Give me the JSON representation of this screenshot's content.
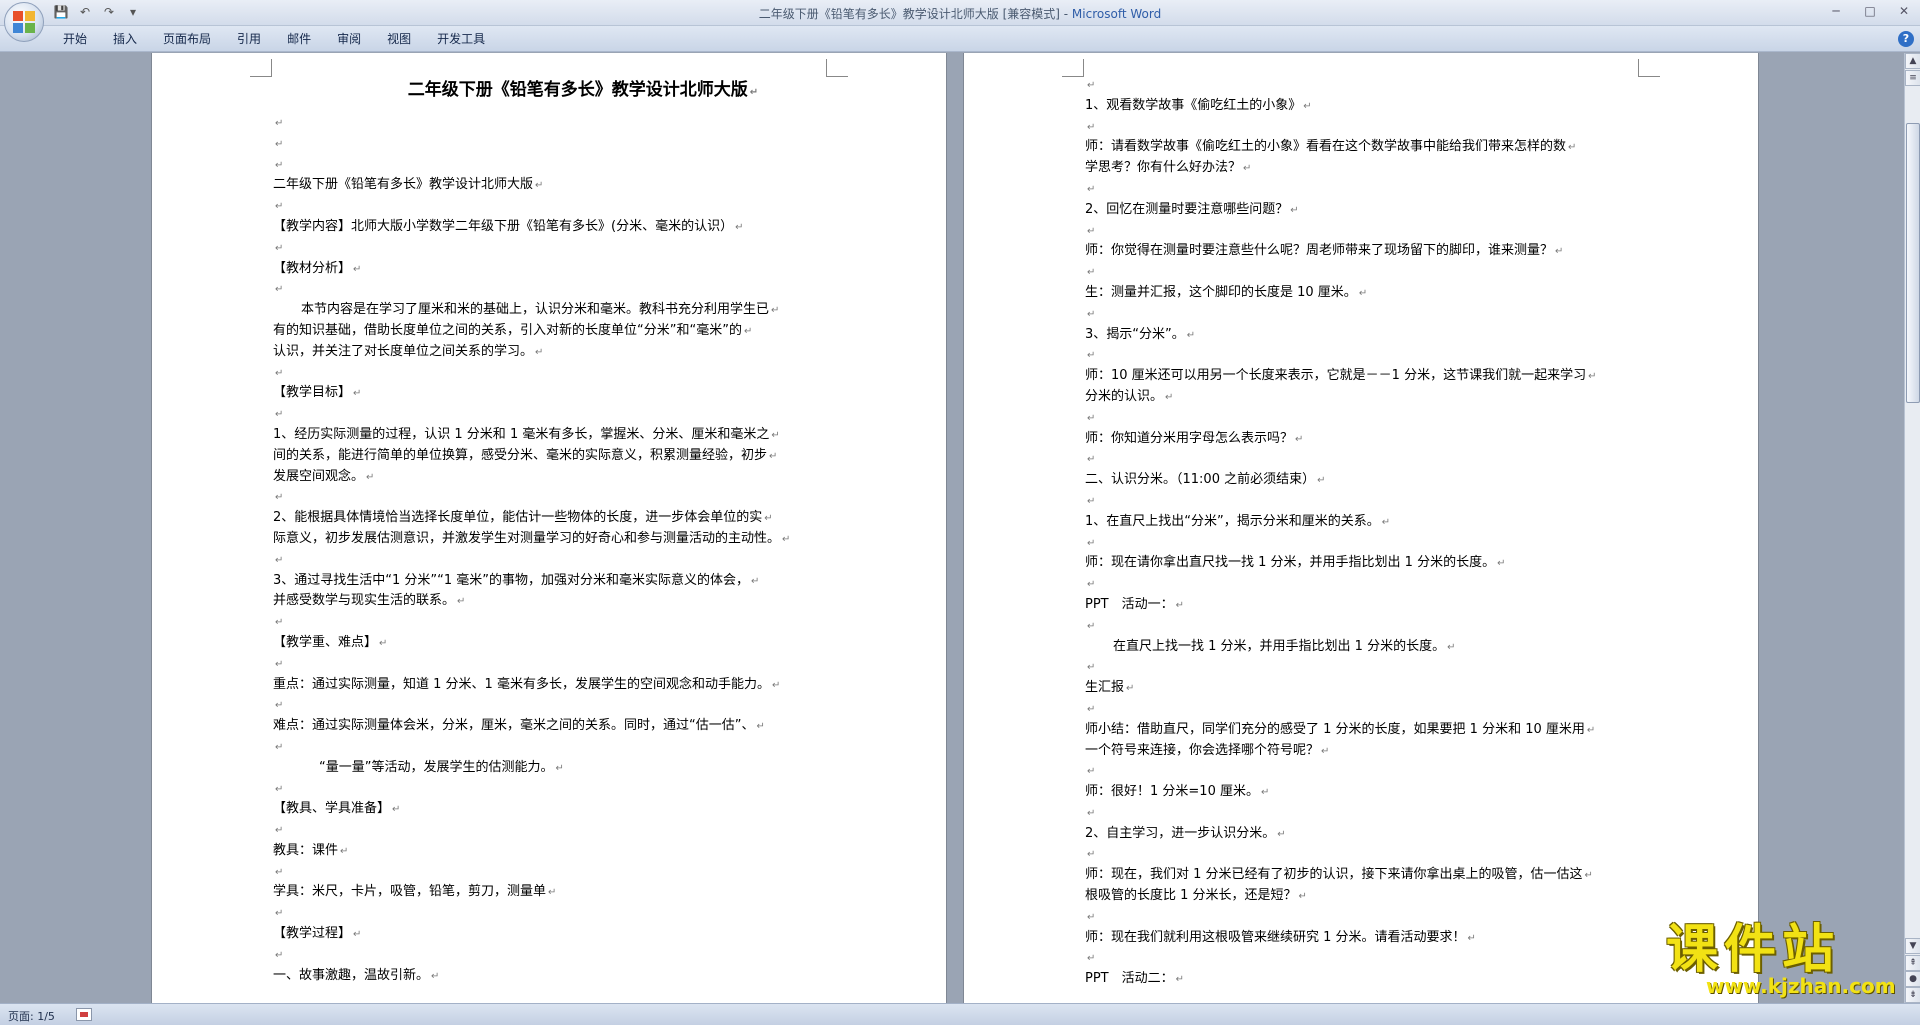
{
  "titlebar": {
    "title_main": "二年级下册《铅笔有多长》教学设计北师大版 [兼容模式] - ",
    "app_name": "Microsoft Word",
    "minimize": "─",
    "maximize": "□",
    "close": "✕"
  },
  "qat": {
    "save": "💾",
    "undo": "↶",
    "redo": "↷",
    "customize": "▾"
  },
  "menu": {
    "tabs": [
      "开始",
      "插入",
      "页面布局",
      "引用",
      "邮件",
      "审阅",
      "视图",
      "开发工具"
    ],
    "help": "?"
  },
  "paragraph_mark": "↵",
  "page_left": {
    "title": "二年级下册《铅笔有多长》教学设计北师大版",
    "lines": [
      "",
      "",
      "",
      "二年级下册《铅笔有多长》教学设计北师大版",
      "",
      "【教学内容】北师大版小学数学二年级下册《铅笔有多长》(分米、毫米的认识）",
      "",
      "【教材分析】",
      "",
      "本节内容是在学习了厘米和米的基础上，认识分米和毫米。教科书充分利用学生已",
      "有的知识基础，借助长度单位之间的关系，引入对新的长度单位“分米”和“毫米”的",
      "认识，并关注了对长度单位之间关系的学习。",
      "",
      "【教学目标】",
      "",
      "1、经历实际测量的过程，认识 1 分米和 1 毫米有多长，掌握米、分米、厘米和毫米之",
      "间的关系，能进行简单的单位换算，感受分米、毫米的实际意义，积累测量经验，初步",
      "发展空间观念。",
      "",
      "2、能根据具体情境恰当选择长度单位，能估计一些物体的长度，进一步体会单位的实",
      "际意义，初步发展估测意识，并激发学生对测量学习的好奇心和参与测量活动的主动性。",
      "",
      "3、通过寻找生活中“1 分米”“1 毫米”的事物，加强对分米和毫米实际意义的体会，",
      "并感受数学与现实生活的联系。",
      "",
      "【教学重、难点】",
      "",
      "重点：通过实际测量，知道 1 分米、1 毫米有多长，发展学生的空间观念和动手能力。",
      "",
      "难点：通过实际测量体会米，分米，厘米，毫米之间的关系。同时，通过“估一估”、",
      "",
      "“量一量”等活动，发展学生的估测能力。",
      "",
      "【教具、学具准备】",
      "",
      "教具：课件",
      "",
      "学具：米尺，卡片，吸管，铅笔，剪刀，测量单",
      "",
      "【教学过程】",
      "",
      "一、故事激趣，温故引新。"
    ]
  },
  "page_right": {
    "lines": [
      "",
      "1、观看数学故事《偷吃红土的小象》",
      "",
      "师：请看数学故事《偷吃红土的小象》看看在这个数学故事中能给我们带来怎样的数",
      "学思考？你有什么好办法？",
      "",
      "2、回忆在测量时要注意哪些问题？",
      "",
      "师：你觉得在测量时要注意些什么呢？周老师带来了现场留下的脚印，谁来测量？",
      "",
      "生：测量并汇报，这个脚印的长度是 10 厘米。",
      "",
      "3、揭示“分米”。",
      "",
      "师：10 厘米还可以用另一个长度来表示，它就是－－1 分米，这节课我们就一起来学习",
      "分米的认识。",
      "",
      "师：你知道分米用字母怎么表示吗？",
      "",
      "二、认识分米。（11:00 之前必须结束）",
      "",
      "1、在直尺上找出“分米”，揭示分米和厘米的关系。",
      "",
      "师：现在请你拿出直尺找一找 1 分米，并用手指比划出 1 分米的长度。",
      "",
      "PPT　活动一：",
      "",
      "在直尺上找一找 1 分米，并用手指比划出 1 分米的长度。",
      "",
      "生汇报",
      "",
      "师小结：借助直尺，同学们充分的感受了 1 分米的长度，如果要把 1 分米和 10 厘米用",
      "一个符号来连接，你会选择哪个符号呢？",
      "",
      "师：很好！1 分米=10 厘米。",
      "",
      "2、自主学习，进一步认识分米。",
      "",
      "师：现在，我们对 1 分米已经有了初步的认识，接下来请你拿出桌上的吸管，估一估这",
      "根吸管的长度比 1 分米长，还是短？",
      "",
      "师：现在我们就利用这根吸管来继续研究 1 分米。请看活动要求！",
      "",
      "PPT　活动二："
    ]
  },
  "statusbar": {
    "page": "页面: 1/5"
  },
  "watermark": {
    "cn": "课件站",
    "url": "www.kjzhan.com"
  },
  "colors": {
    "title_blue": "#2f5da8",
    "workspace": "#9aa4b4",
    "watermark_yellow": "#f2e214"
  }
}
